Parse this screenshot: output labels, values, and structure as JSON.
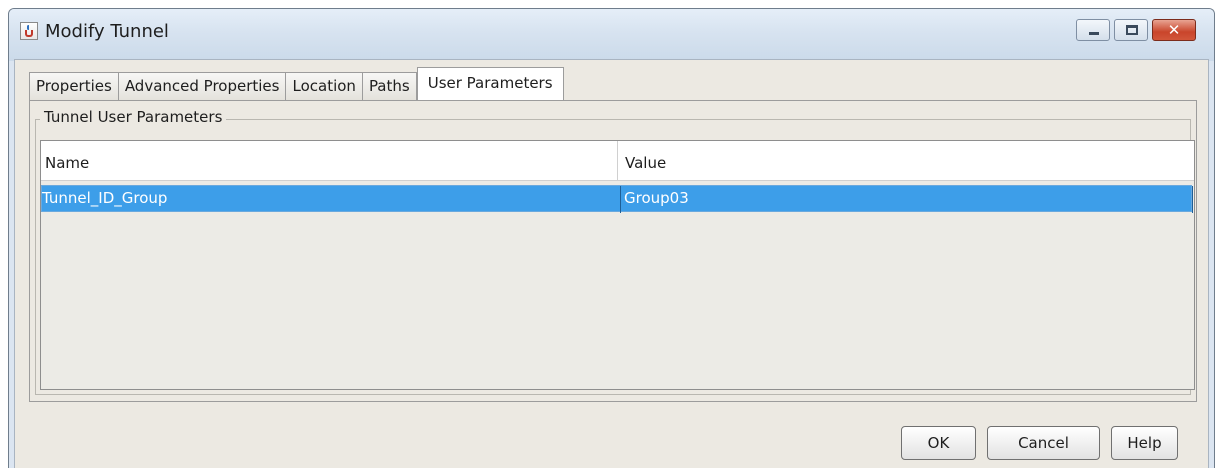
{
  "window": {
    "title": "Modify Tunnel",
    "icon": "java-cup-icon",
    "controls": {
      "minimize_icon": "minimize-icon",
      "maximize_icon": "maximize-icon",
      "close_glyph": "✕"
    }
  },
  "tabs": [
    {
      "label": "Properties",
      "active": false
    },
    {
      "label": "Advanced Properties",
      "active": false
    },
    {
      "label": "Location",
      "active": false
    },
    {
      "label": "Paths",
      "active": false
    },
    {
      "label": "User Parameters",
      "active": true
    }
  ],
  "panel": {
    "group_label": "Tunnel User Parameters",
    "table": {
      "columns": [
        "Name",
        "Value"
      ],
      "rows": [
        {
          "name": "Tunnel_ID_Group",
          "value": "Group03",
          "selected": true
        }
      ]
    }
  },
  "buttons": {
    "ok": "OK",
    "cancel": "Cancel",
    "help": "Help"
  },
  "colors": {
    "selection": "#3d9ee9",
    "dialog_background": "#ece9e2",
    "close_button": "#c9452b"
  }
}
